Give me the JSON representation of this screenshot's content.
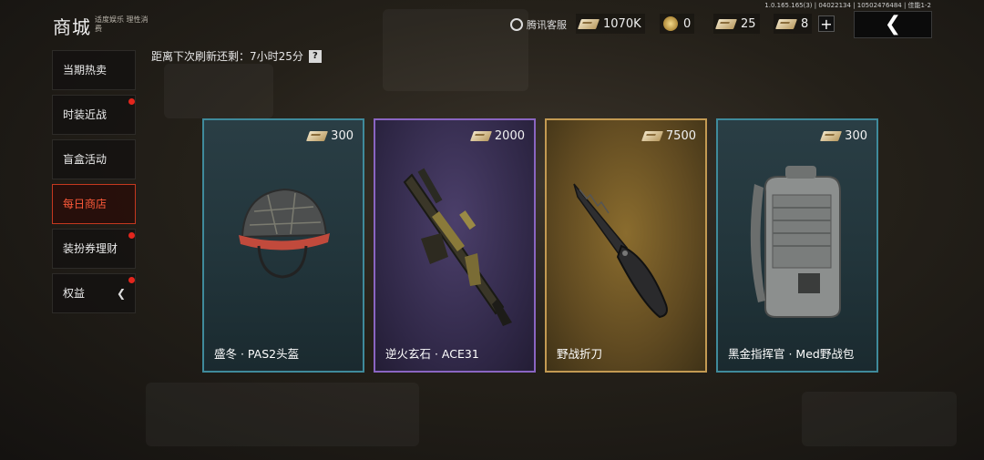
{
  "header": {
    "title": "商城",
    "subtitle": "适度娱乐 理性消费",
    "version": "1.0.165.165(3) | 04022134 | 10502476484 | 佳能1-2",
    "service_label": "腾讯客服"
  },
  "currencies": [
    {
      "icon": "ticket-icon",
      "value": "1070K"
    },
    {
      "icon": "coin-icon",
      "value": "0"
    },
    {
      "icon": "voucher-icon",
      "value": "25"
    },
    {
      "icon": "ticket-stack-icon",
      "value": "8"
    }
  ],
  "plus_label": "+",
  "back_label": "❮",
  "sidebar": {
    "items": [
      {
        "label": "当期热卖",
        "active": false,
        "dot": false
      },
      {
        "label": "时装近战",
        "active": false,
        "dot": true
      },
      {
        "label": "盲盒活动",
        "active": false,
        "dot": false
      },
      {
        "label": "每日商店",
        "active": true,
        "dot": false
      },
      {
        "label": "装扮券理财",
        "active": false,
        "dot": true
      },
      {
        "label": "权益",
        "active": false,
        "dot": true,
        "arrow": "❮"
      }
    ]
  },
  "refresh": {
    "label": "距离下次刷新还剩：7小时25分",
    "help": "?"
  },
  "cards": [
    {
      "name": "盛冬 · PAS2头盔",
      "price": "300",
      "rarity_color": "#3f8a9b"
    },
    {
      "name": "逆火玄石 · ACE31",
      "price": "2000",
      "rarity_color": "#8a65c2"
    },
    {
      "name": "野战折刀",
      "price": "7500",
      "rarity_color": "#c39a52"
    },
    {
      "name": "黑金指挥官 · Med野战包",
      "price": "300",
      "rarity_color": "#3f8a9b"
    }
  ]
}
